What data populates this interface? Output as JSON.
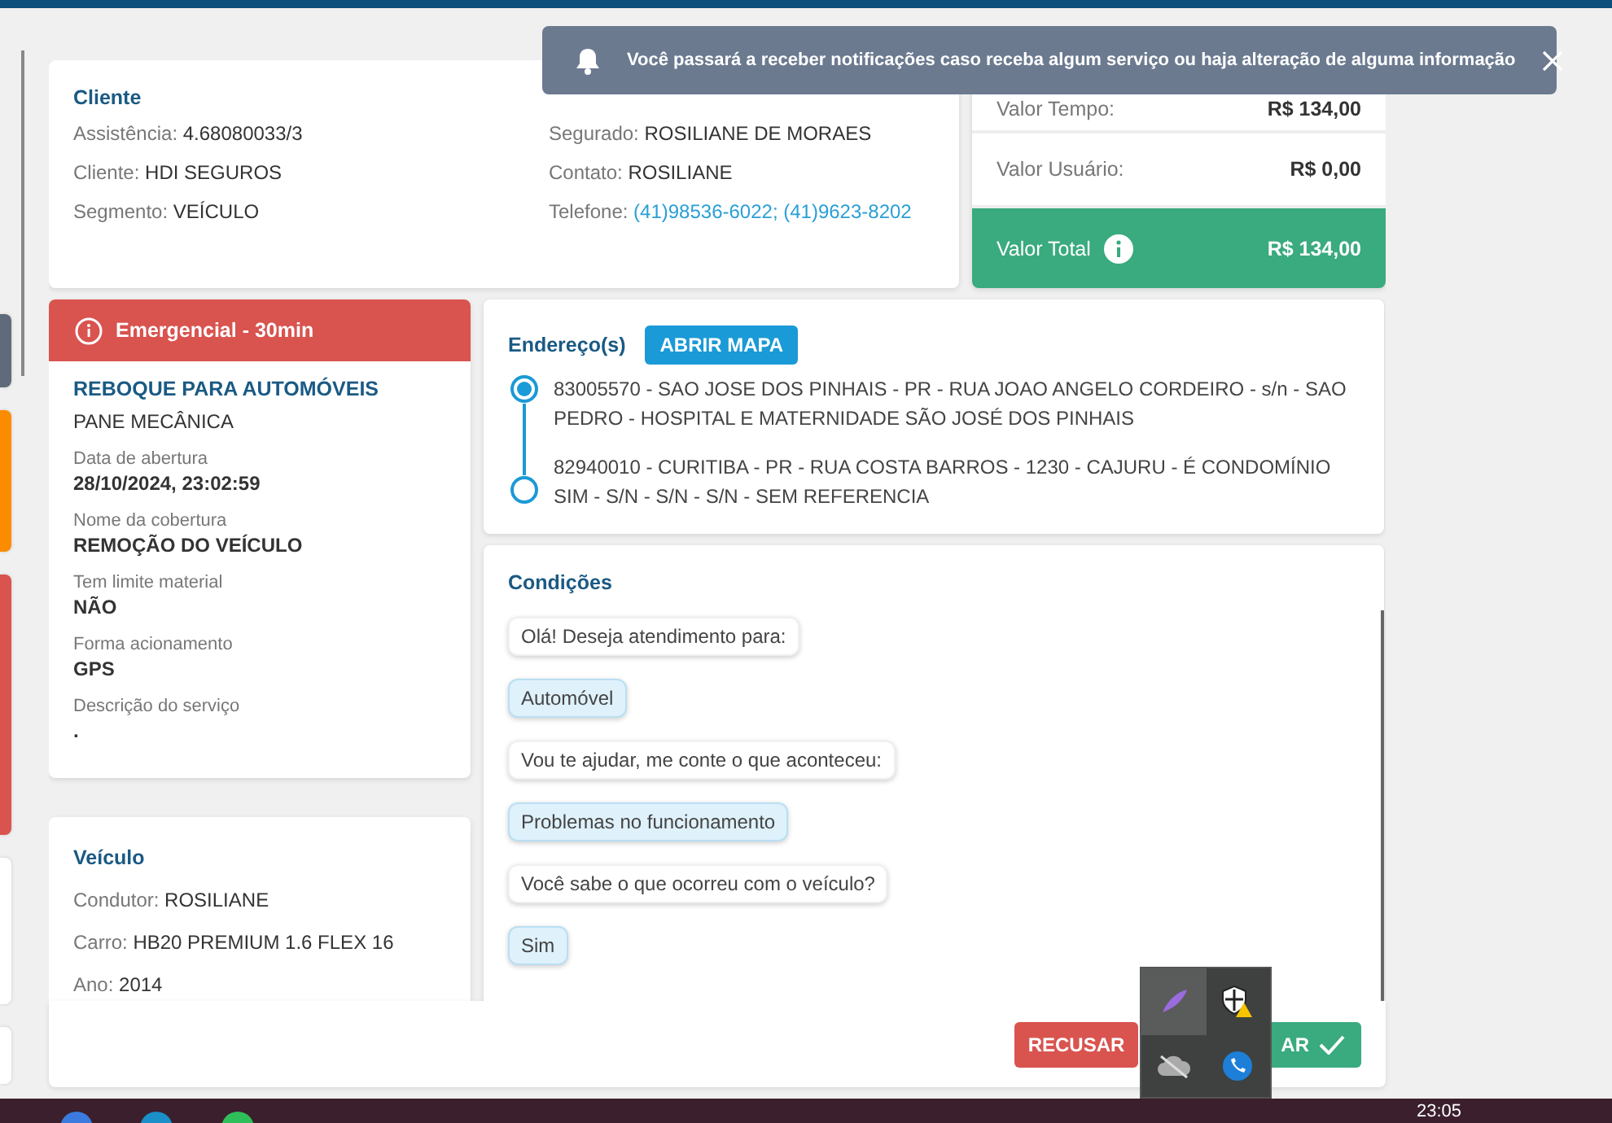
{
  "notification": {
    "text": "Você passará a receber notificações caso receba algum serviço ou haja alteração de alguma informação"
  },
  "side_tabs": [
    {
      "color": "#5f6b7a"
    },
    {
      "color": "#fb8c00"
    },
    {
      "color": "#d9534f"
    },
    {
      "color": "#ffffff"
    },
    {
      "color": "#ffffff"
    }
  ],
  "client": {
    "title": "Cliente",
    "fields_left": [
      {
        "label": "Assistência:",
        "value": "4.68080033/3",
        "kind": "text"
      },
      {
        "label": "Cliente:",
        "value": "HDI SEGUROS",
        "kind": "text"
      },
      {
        "label": "Segmento:",
        "value": "VEÍCULO",
        "kind": "text"
      }
    ],
    "fields_right": [
      {
        "label": "Segurado:",
        "value": "ROSILIANE DE MORAES",
        "kind": "text"
      },
      {
        "label": "Contato:",
        "value": "ROSILIANE",
        "kind": "text"
      },
      {
        "label": "Telefone:",
        "value": "(41)98536-6022; (41)9623-8202",
        "kind": "link"
      }
    ]
  },
  "values": [
    {
      "label": "Valor Tempo:",
      "amount": "R$ 134,00",
      "kind": "row"
    },
    {
      "label": "Valor Usuário:",
      "amount": "R$ 0,00",
      "kind": "row"
    },
    {
      "label": "Valor Total",
      "amount": "R$ 134,00",
      "kind": "total"
    }
  ],
  "service": {
    "badge": "Emergencial - 30min",
    "title": "REBOQUE PARA AUTOMÓVEIS",
    "subtitle": "PANE MECÂNICA",
    "details": [
      {
        "label": "Data de abertura",
        "value": "28/10/2024, 23:02:59"
      },
      {
        "label": "Nome da cobertura",
        "value": "REMOÇÃO DO VEÍCULO"
      },
      {
        "label": "Tem limite material",
        "value": "NÃO"
      },
      {
        "label": "Forma acionamento",
        "value": "GPS"
      },
      {
        "label": "Descrição do serviço",
        "value": "."
      }
    ]
  },
  "vehicle": {
    "title": "Veículo",
    "fields": [
      {
        "label": "Condutor:",
        "value": "ROSILIANE"
      },
      {
        "label": "Carro:",
        "value": "HB20 PREMIUM 1.6 FLEX 16"
      },
      {
        "label": "Ano:",
        "value": "2014"
      }
    ]
  },
  "addresses": {
    "title": "Endereço(s)",
    "map_button": "ABRIR MAPA",
    "items": [
      {
        "text": "83005570 - SAO JOSE DOS PINHAIS - PR - RUA JOAO ANGELO CORDEIRO - s/n - SAO PEDRO - HOSPITAL E MATERNIDADE SÃO JOSÉ DOS PINHAIS",
        "kind": "origin"
      },
      {
        "text": "82940010 - CURITIBA - PR - RUA COSTA BARROS - 1230 - CAJURU - É CONDOMÍNIO SIM - S/N - S/N - S/N - SEM REFERENCIA",
        "kind": "destination"
      }
    ]
  },
  "conditions": {
    "title": "Condições",
    "messages": [
      {
        "text": "Olá! Deseja atendimento para:",
        "kind": "question"
      },
      {
        "text": "Automóvel",
        "kind": "answer"
      },
      {
        "text": "Vou te ajudar, me conte o que aconteceu:",
        "kind": "question"
      },
      {
        "text": "Problemas no funcionamento",
        "kind": "answer"
      },
      {
        "text": "Você sabe o que ocorreu com o veículo?",
        "kind": "question"
      },
      {
        "text": "Sim",
        "kind": "answer"
      }
    ]
  },
  "footer": {
    "reject": "RECUSAR",
    "accept": "AR"
  },
  "taskbar": {
    "clock": "23:05"
  }
}
